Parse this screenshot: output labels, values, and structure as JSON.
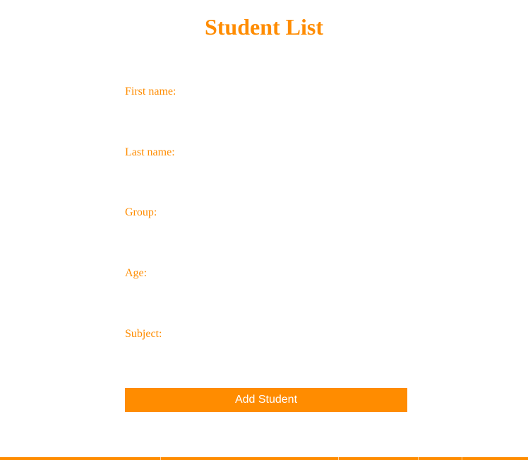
{
  "page": {
    "title": "Student List"
  },
  "form": {
    "fields": [
      {
        "label": "First name:",
        "value": ""
      },
      {
        "label": "Last name:",
        "value": ""
      },
      {
        "label": "Group:",
        "value": ""
      },
      {
        "label": "Age:",
        "value": ""
      },
      {
        "label": "Subject:",
        "value": ""
      }
    ],
    "submit_label": "Add Student"
  },
  "colors": {
    "accent": "#ff8c00",
    "background": "#ffffff",
    "button_text": "#ffffff"
  }
}
